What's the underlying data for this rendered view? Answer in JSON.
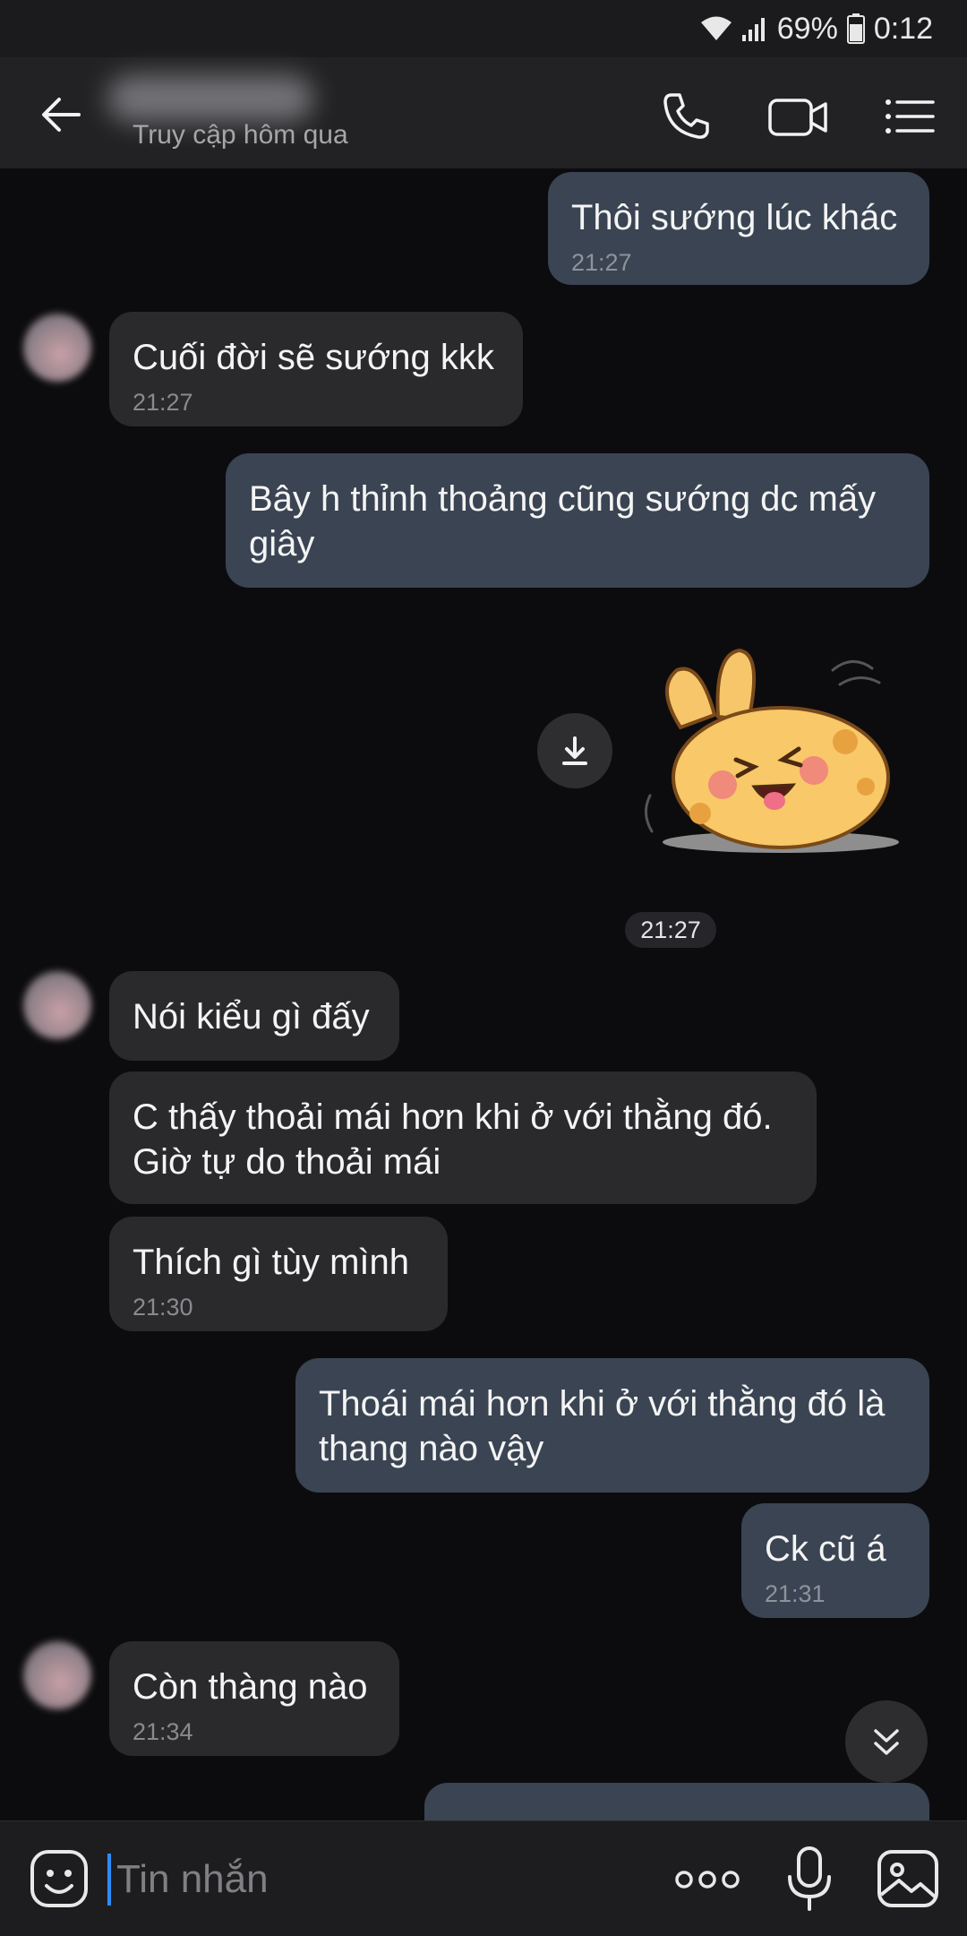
{
  "status_bar": {
    "battery_percent": "69%",
    "time": "0:12"
  },
  "header": {
    "last_seen": "Truy cập hôm qua",
    "icons": [
      "back-arrow-icon",
      "phone-icon",
      "video-call-icon",
      "menu-list-icon"
    ]
  },
  "messages": [
    {
      "from": "me",
      "text": "Thôi sướng lúc khác",
      "time": "21:27"
    },
    {
      "from": "them",
      "text": "Cuối đời sẽ sướng kkk",
      "time": "21:27"
    },
    {
      "from": "me",
      "text": "Bây h thỉnh thoảng cũng sướng dc mấy giây",
      "time": ""
    },
    {
      "from": "me",
      "type": "sticker",
      "time": ""
    },
    {
      "from": "them",
      "text": "Nói kiểu gì đấy",
      "time": ""
    },
    {
      "from": "them",
      "text": "C thấy thoải mái hơn khi ở với thằng đó. Giờ tự do thoải mái",
      "time": ""
    },
    {
      "from": "them",
      "text": "Thích gì tùy mình",
      "time": "21:30"
    },
    {
      "from": "me",
      "text": "Thoái mái hơn khi ở với thằng đó là thang nào vậy",
      "time": ""
    },
    {
      "from": "me",
      "text": "Ck cũ á",
      "time": "21:31"
    },
    {
      "from": "them",
      "text": "Còn thàng nào",
      "time": "21:34"
    }
  ],
  "sticker_time_chip": "21:27",
  "input": {
    "placeholder": "Tin nhắn"
  },
  "colors": {
    "outgoing_bubble": "#3a4453",
    "incoming_bubble": "#2a2a2d",
    "background": "#0c0c0e",
    "caret": "#2f8cff"
  }
}
